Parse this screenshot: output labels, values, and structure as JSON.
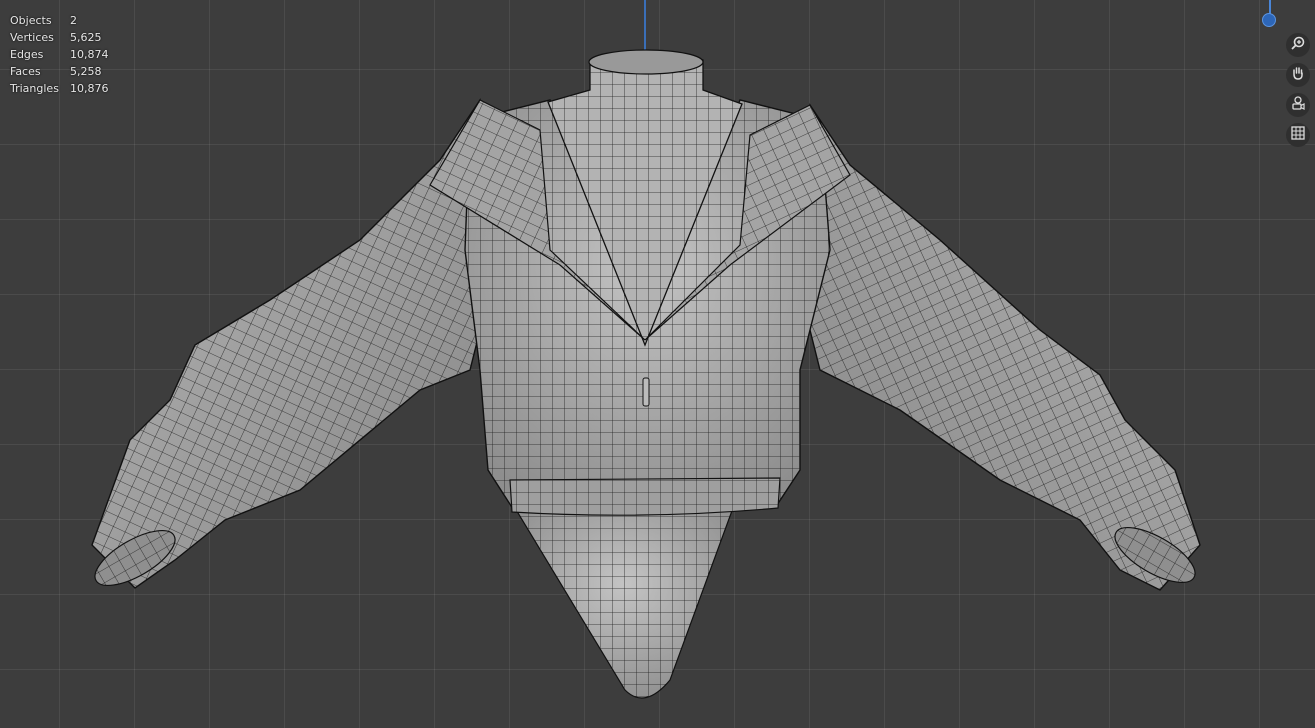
{
  "stats": {
    "rows": [
      {
        "label": "Objects",
        "value": "2"
      },
      {
        "label": "Vertices",
        "value": "5,625"
      },
      {
        "label": "Edges",
        "value": "10,874"
      },
      {
        "label": "Faces",
        "value": "5,258"
      },
      {
        "label": "Triangles",
        "value": "10,876"
      }
    ]
  },
  "navigation": {
    "buttons": [
      {
        "name": "zoom-icon"
      },
      {
        "name": "hand-pan-icon"
      },
      {
        "name": "camera-view-icon"
      },
      {
        "name": "orthographic-grid-icon"
      }
    ]
  },
  "gizmo": {
    "axis_color": "#2d66b8"
  },
  "mesh": {
    "color": "#a9a9a9",
    "wire_color": "#1a1a1a"
  }
}
